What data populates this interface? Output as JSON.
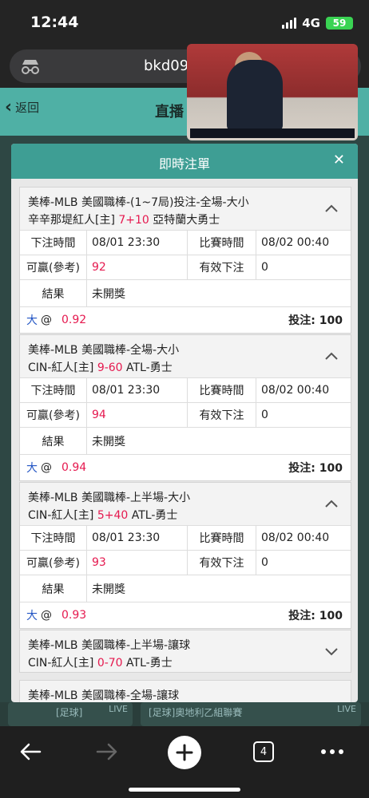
{
  "status": {
    "time": "12:44",
    "network": "4G",
    "battery": "59"
  },
  "browser": {
    "url": "bkd09"
  },
  "page": {
    "back_label": "返回",
    "title": "直播"
  },
  "modal": {
    "title": "即時注單",
    "labels": {
      "bet_time": "下注時間",
      "match_time": "比賽時間",
      "win": "可贏(參考)",
      "valid": "有效下注",
      "result": "結果",
      "at": "@",
      "stake": "投注:"
    },
    "bets": [
      {
        "league": "美棒-MLB 美國職棒-(1~7局)投注-全場-大小",
        "home": "辛辛那堤紅人[主]",
        "score": "7+10",
        "away": "亞特蘭大勇士",
        "bet_time": "08/01 23:30",
        "match_time": "08/02 00:40",
        "win": "92",
        "valid": "0",
        "result": "未開獎",
        "pick": "大",
        "odds": "0.92",
        "stake": "100",
        "expanded": true
      },
      {
        "league": "美棒-MLB 美國職棒-全場-大小",
        "home": "CIN-紅人[主]",
        "score": "9-60",
        "away": "ATL-勇士",
        "bet_time": "08/01 23:30",
        "match_time": "08/02 00:40",
        "win": "94",
        "valid": "0",
        "result": "未開獎",
        "pick": "大",
        "odds": "0.94",
        "stake": "100",
        "expanded": true
      },
      {
        "league": "美棒-MLB 美國職棒-上半場-大小",
        "home": "CIN-紅人[主]",
        "score": "5+40",
        "away": "ATL-勇士",
        "bet_time": "08/01 23:30",
        "match_time": "08/02 00:40",
        "win": "93",
        "valid": "0",
        "result": "未開獎",
        "pick": "大",
        "odds": "0.93",
        "stake": "100",
        "expanded": true
      },
      {
        "league": "美棒-MLB 美國職棒-上半場-讓球",
        "home": "CIN-紅人[主]",
        "score": "0-70",
        "away": "ATL-勇士",
        "expanded": false
      },
      {
        "league": "美棒-MLB 美國職棒-全場-讓球",
        "expanded": false
      }
    ]
  },
  "live_strip": {
    "items": [
      {
        "label": "[足球]",
        "tag": "LIVE"
      },
      {
        "label": "[足球]奧地利乙組聯賽",
        "tag": "LIVE"
      }
    ]
  },
  "toolbar": {
    "tabs_count": "4"
  },
  "colors": {
    "accent": "#3e9e94",
    "score_red": "#e5194f",
    "pick_blue": "#2255c4"
  }
}
